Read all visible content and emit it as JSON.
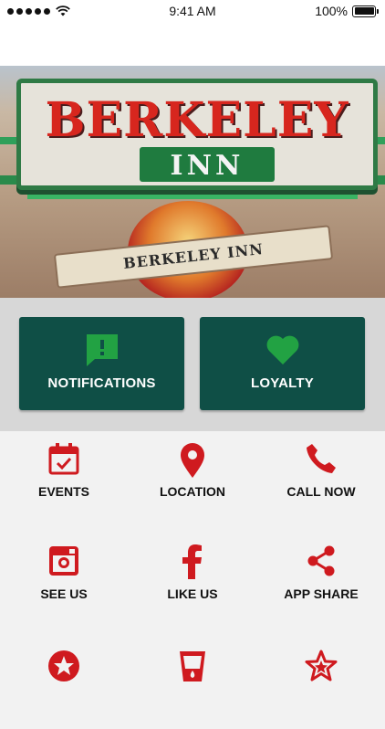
{
  "status_bar": {
    "time": "9:41 AM",
    "battery": "100%"
  },
  "hero": {
    "sign_title": "BERKELEY",
    "sign_subtitle": "INN",
    "banner_text": "BERKELEY INN"
  },
  "actions": [
    {
      "label": "NOTIFICATIONS",
      "icon": "chat-alert-icon"
    },
    {
      "label": "LOYALTY",
      "icon": "heart-icon"
    }
  ],
  "menu": {
    "items": [
      {
        "label": "EVENTS",
        "icon": "calendar-icon"
      },
      {
        "label": "LOCATION",
        "icon": "map-pin-icon"
      },
      {
        "label": "CALL NOW",
        "icon": "phone-icon"
      },
      {
        "label": "SEE US",
        "icon": "instagram-icon"
      },
      {
        "label": "LIKE US",
        "icon": "facebook-icon"
      },
      {
        "label": "APP SHARE",
        "icon": "share-icon"
      },
      {
        "label": "",
        "icon": "star-circle-icon"
      },
      {
        "label": "",
        "icon": "cup-icon"
      },
      {
        "label": "",
        "icon": "star-outline-icon"
      }
    ]
  },
  "colors": {
    "action_bg": "#0f4f46",
    "action_icon": "#22a243",
    "menu_icon": "#cf1a1f",
    "panel_bg": "#d7d7d7",
    "grid_bg": "#f2f2f2"
  }
}
